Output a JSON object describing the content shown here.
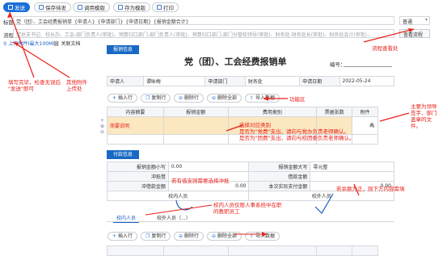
{
  "toolbar": {
    "send": "发送",
    "save_draft": "保存待发",
    "call_template": "调用模版",
    "save_template": "存为模版",
    "print": "打印"
  },
  "form_header": {
    "title_label": "标题",
    "title_value": "党（团）、工会经费报销单_{申请人}_{申请部门}_{申请日期}_{报销金额合计}",
    "title_mode": "普通",
    "flow_label": "流程",
    "flow_value": "党总支书记、校长办、工会-部门负责人(审批)、预算归口部门-部门负责人(审批)、预算归口部门-部门分管校领导(审批)、财务处-财务处长(审批)、财务处会计(审批)...",
    "flow_button": "查看流程",
    "attachment_label": "上传附件(最大100M)",
    "related_doc": "关联文档"
  },
  "main_form": {
    "section_tab": "报销信息",
    "title": "党（团）、工会经费报销单",
    "number_label": "编号：",
    "applicant_label": "申请人",
    "applicant_value": "谭咏梅",
    "department_label": "申请部门",
    "department_value": "财务处",
    "date_label": "申请日期",
    "date_value": "2022-05-24",
    "row_buttons": [
      "插入行",
      "复制行",
      "删除行",
      "删除全部",
      "导入数据"
    ],
    "columns": [
      "内容摘要",
      "报销金额",
      "费用类别",
      "票据张数",
      "附件"
    ],
    "rows": [
      {
        "summary": "简要说明",
        "amount": "",
        "category": "",
        "receipts": "",
        "attachment": ""
      }
    ],
    "payment_tab": "付款信息",
    "total_amount_label": "报销金额小写",
    "total_amount_value": "0.00",
    "total_upper_label": "报销金额大写",
    "total_upper_value": "零元整",
    "offset_loan_label": "冲抵借",
    "loan_amount_label": "借款金额",
    "offset_amount_label": "冲借款金额",
    "offset_amount_value": "0.00",
    "actual_pay_label": "本次实际支付金额",
    "actual_pay_value": "0.00",
    "school_staff_label": "校内人员",
    "school_staff_label2": "校外人员",
    "staff_tabs": [
      "校内人员",
      "校外人员（...）"
    ]
  },
  "annotations": {
    "a1": "填写完毕，检查无误后\n\"发送\"即可",
    "a2": "其他附件\n上传处",
    "a3": "流程查看处",
    "a4": "功能区",
    "a5": "选择对应类别\n是否为\"党费\"支出，请向与党办负责老师确认。\n是否为\"团费\"支出，请向与校团委负责老师确认。",
    "a6": "主要为领导\n签字、部门\n盖章的文\n件。",
    "a7": "若有借支则需要选择冲抵",
    "a8": "若余额为正，则下方内容需填",
    "a9": "校内人员仅限人事系统中在职\n的教职员工"
  },
  "colors": {
    "accent": "#1a6fd8",
    "annotation": "#e8201a",
    "highlight": "#fbe7c0"
  }
}
